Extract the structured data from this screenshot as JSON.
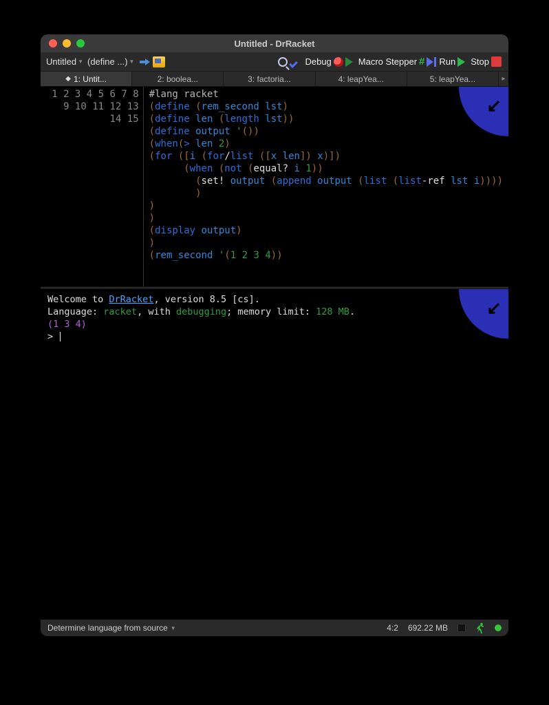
{
  "window": {
    "title": "Untitled - DrRacket"
  },
  "toolbar": {
    "file_menu": "Untitled",
    "define_menu": "(define ...)",
    "debug": "Debug",
    "macro": "Macro Stepper",
    "run": "Run",
    "stop": "Stop"
  },
  "tabs": [
    {
      "label": "1: Untit...",
      "active": true,
      "dirty": true
    },
    {
      "label": "2: boolea...",
      "active": false,
      "dirty": false
    },
    {
      "label": "3: factoria...",
      "active": false,
      "dirty": false
    },
    {
      "label": "4: leapYea...",
      "active": false,
      "dirty": false
    },
    {
      "label": "5: leapYea...",
      "active": false,
      "dirty": false
    }
  ],
  "code": {
    "lines": [
      "#lang racket",
      "(define (rem_second lst)",
      "(define len (length lst))",
      "(define output '())",
      "(when(> len 2)",
      "(for ([i (for/list ([x len]) x)])",
      "      (when (not (equal? i 1))",
      "        (set! output (append output (list (list-ref lst i))))",
      "        )",
      ")",
      ")",
      "(display output)",
      ")",
      "(rem_second '(1 2 3 4))",
      ""
    ]
  },
  "repl": {
    "welcome_pre": "Welcome to ",
    "welcome_link": "DrRacket",
    "welcome_post": ", version 8.5 [cs].",
    "lang_pre": "Language: ",
    "lang": "racket",
    "dbg_pre": ", with ",
    "dbg": "debugging",
    "dbg_post": "; memory limit: ",
    "mem": "128 MB",
    "period": ".",
    "output": "(1 3 4)",
    "prompt": ">"
  },
  "status": {
    "lang_source": "Determine language from source",
    "position": "4:2",
    "memory": "692.22 MB"
  }
}
